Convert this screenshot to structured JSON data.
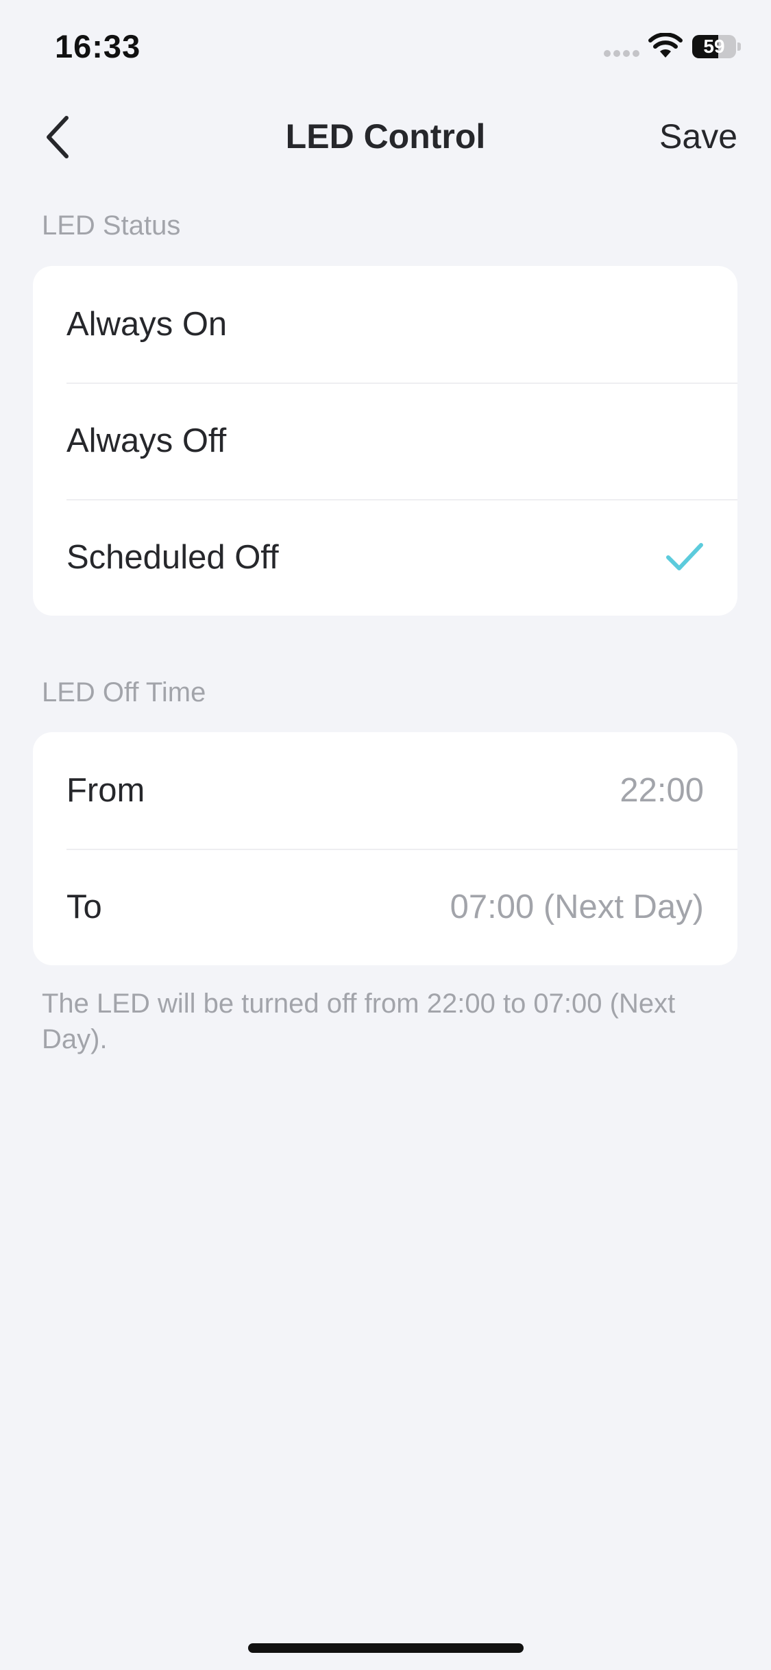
{
  "status_bar": {
    "time": "16:33",
    "battery_level": "59",
    "battery_fraction": 0.59
  },
  "nav": {
    "title": "LED Control",
    "save_label": "Save",
    "back_icon": "chevron-left-icon"
  },
  "led_status": {
    "header": "LED Status",
    "options": [
      {
        "label": "Always On",
        "selected": false
      },
      {
        "label": "Always Off",
        "selected": false
      },
      {
        "label": "Scheduled Off",
        "selected": true
      }
    ],
    "accent_color": "#5ccbdc"
  },
  "led_off_time": {
    "header": "LED Off Time",
    "from_label": "From",
    "from_value": "22:00",
    "to_label": "To",
    "to_value": "07:00 (Next Day)",
    "note": "The LED will be turned off from 22:00 to 07:00 (Next Day)."
  }
}
